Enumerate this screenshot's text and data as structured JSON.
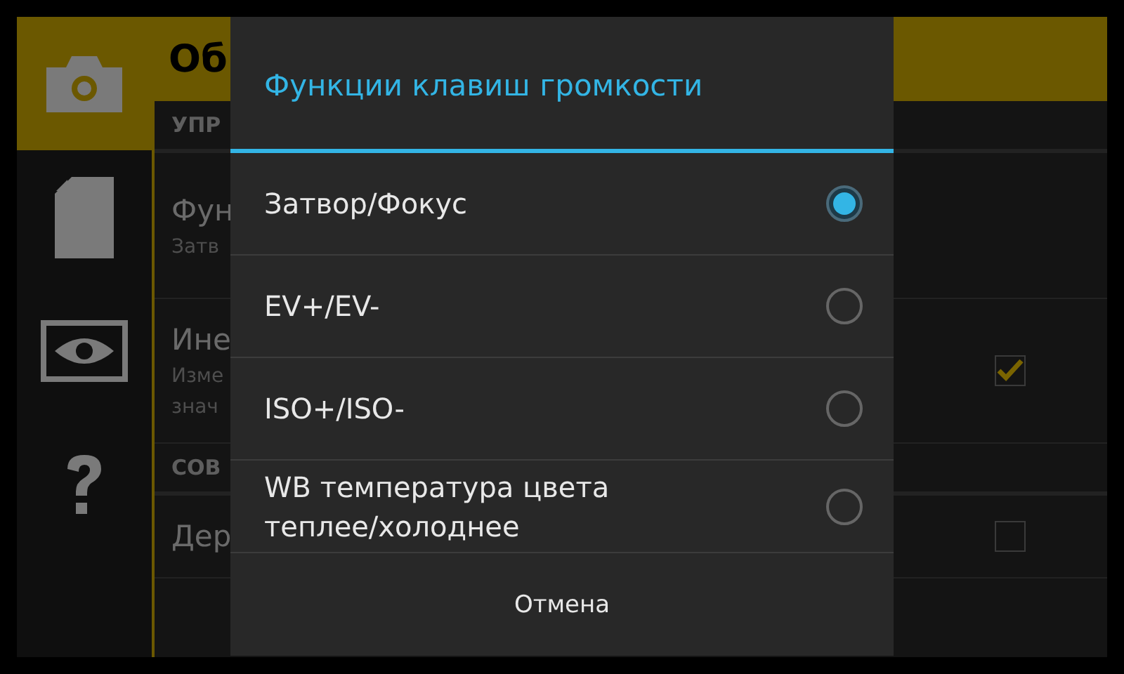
{
  "sidebar": {
    "items": [
      {
        "selected": true
      },
      {
        "selected": false
      },
      {
        "selected": false
      },
      {
        "selected": false
      }
    ]
  },
  "screen": {
    "title": "Об",
    "sections": [
      {
        "header": "УПР",
        "rows": [
          {
            "title": "Фун",
            "lines": [
              "Затв"
            ]
          },
          {
            "title": "Ине",
            "lines": [
              "Изме",
              "знач"
            ],
            "checked": true
          }
        ]
      },
      {
        "header": "СОВ",
        "rows": [
          {
            "title": "Дер",
            "lines": [],
            "checked": false
          }
        ]
      }
    ]
  },
  "dialog": {
    "title": "Функции клавиш громкости",
    "options": [
      {
        "label": "Затвор/Фокус",
        "selected": true
      },
      {
        "label": "EV+/EV-",
        "selected": false
      },
      {
        "label": "ISO+/ISO-",
        "selected": false
      },
      {
        "label": "WB температура цвета теплее/холоднее",
        "selected": false
      }
    ],
    "cancel": "Отмена"
  }
}
